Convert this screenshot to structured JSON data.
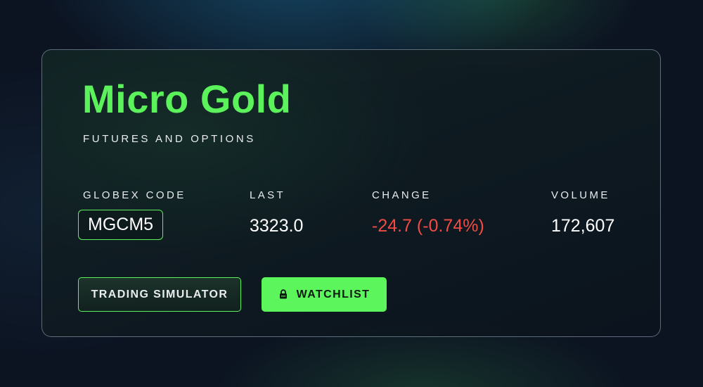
{
  "header": {
    "title": "Micro Gold",
    "subtitle": "FUTURES AND OPTIONS"
  },
  "stats": {
    "globex_code": {
      "label": "GLOBEX CODE",
      "value": "MGCM5"
    },
    "last": {
      "label": "LAST",
      "value": "3323.0"
    },
    "change": {
      "label": "CHANGE",
      "value": "-24.7 (-0.74%)"
    },
    "volume": {
      "label": "VOLUME",
      "value": "172,607"
    }
  },
  "actions": {
    "trading_simulator_label": "TRADING SIMULATOR",
    "watchlist_label": "WATCHLIST",
    "watchlist_icon": "lock-icon"
  },
  "colors": {
    "accent": "#5bf25b",
    "negative": "#f04b45",
    "background": "#0c1422"
  }
}
